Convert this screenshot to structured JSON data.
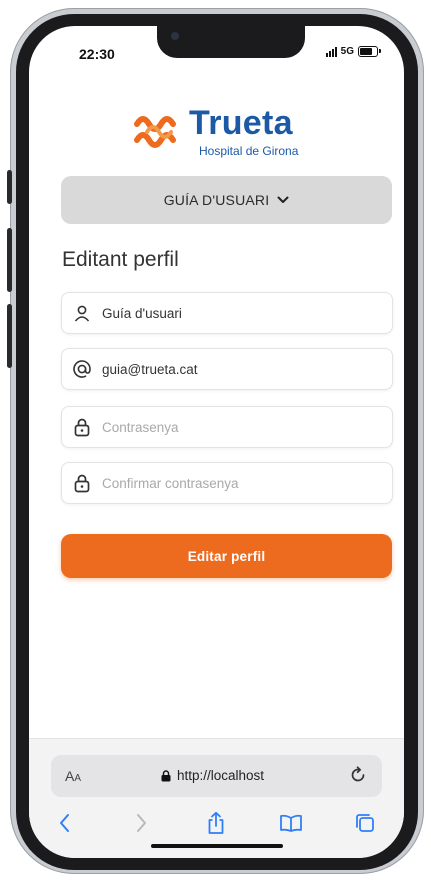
{
  "status_bar": {
    "time": "22:30",
    "network": "5G",
    "signal_bars": 4,
    "battery_level": 0.85
  },
  "brand": {
    "name": "Trueta",
    "subtitle": "Hospital de Girona",
    "primary_color": "#1c5aa6",
    "accent_color": "#ec6b1e"
  },
  "user_menu": {
    "label": "GUÍA D'USUARI",
    "icon": "chevron-down-icon"
  },
  "page": {
    "title": "Editant perfil"
  },
  "form": {
    "name": {
      "value": "Guía d'usuari",
      "icon": "user-icon"
    },
    "email": {
      "value": "guia@trueta.cat",
      "icon": "at-icon"
    },
    "password": {
      "placeholder": "Contrasenya",
      "icon": "lock-icon"
    },
    "confirm_password": {
      "placeholder": "Confirmar contrasenya",
      "icon": "lock-icon"
    },
    "submit_label": "Editar perfil"
  },
  "browser": {
    "text_size_label": "AA",
    "url": "http://localhost",
    "toolbar_icons": [
      "back-icon",
      "forward-icon",
      "share-icon",
      "bookmarks-icon",
      "tabs-icon"
    ]
  }
}
